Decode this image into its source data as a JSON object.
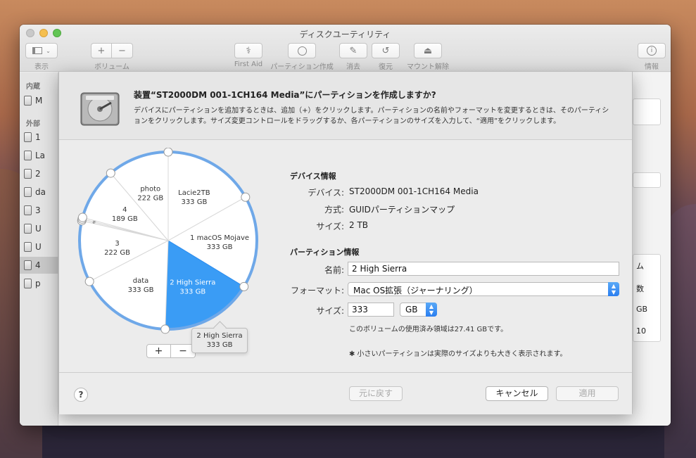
{
  "window": {
    "title": "ディスクユーティリティ"
  },
  "toolbar": {
    "view_label": "表示",
    "volume_label": "ボリューム",
    "volume_add": "+",
    "volume_remove": "−",
    "firstaid_label": "First Aid",
    "partition_label": "パーティション作成",
    "erase_label": "消去",
    "restore_label": "復元",
    "unmount_label": "マウント解除",
    "info_label": "情報"
  },
  "sidebar": {
    "internal_header": "内蔵",
    "external_header": "外部",
    "items": [
      "M",
      "1",
      "La",
      "2",
      "da",
      "3",
      "U",
      "U",
      "4",
      "p"
    ]
  },
  "background_panel": {
    "fragments": [
      "ム",
      "数",
      "GB",
      "10"
    ]
  },
  "sheet": {
    "title": "装置“ST2000DM 001-1CH164 Media”にパーティションを作成しますか?",
    "desc_line1": "デバイスにパーティションを追加するときは、追加（+）をクリックします。パーティションの名前やフォーマットを変更するときは、そのパーティシ",
    "desc_line2": "ョンをクリックします。サイズ変更コントロールをドラッグするか、各パーティションのサイズを入力して、“適用”をクリックします。"
  },
  "pie": {
    "total_gb": 2000,
    "slices": [
      {
        "name": "Lacie2TB",
        "size": "333 GB",
        "gb": 333,
        "selected": false
      },
      {
        "name": "1 macOS Mojave",
        "size": "333 GB",
        "gb": 333,
        "selected": false
      },
      {
        "name": "2 High Sierra",
        "size": "333 GB",
        "gb": 333,
        "selected": true
      },
      {
        "name": "data",
        "size": "333 GB",
        "gb": 333,
        "selected": false
      },
      {
        "name": "3",
        "size": "222 GB",
        "gb": 222,
        "selected": false
      },
      {
        "name": "*",
        "size": "",
        "gb": 6,
        "selected": false
      },
      {
        "name": "*",
        "size": "",
        "gb": 6,
        "selected": false
      },
      {
        "name": "4",
        "size": "189 GB",
        "gb": 189,
        "selected": false
      },
      {
        "name": "photo",
        "size": "222 GB",
        "gb": 222,
        "selected": false
      }
    ],
    "add_button": "+",
    "remove_button": "−",
    "tooltip_name": "2 High Sierra",
    "tooltip_size": "333 GB"
  },
  "colors": {
    "accent": "#2a8cf0",
    "selected_slice": "#3a9cf5",
    "pie_border": "#6fa8e8"
  },
  "device_info": {
    "header": "デバイス情報",
    "device_label": "デバイス:",
    "device_value": "ST2000DM 001-1CH164 Media",
    "scheme_label": "方式:",
    "scheme_value": "GUIDパーティションマップ",
    "size_label": "サイズ:",
    "size_value": "2 TB"
  },
  "partition_info": {
    "header": "パーティション情報",
    "name_label": "名前:",
    "name_value": "2 High Sierra",
    "format_label": "フォーマット:",
    "format_value": "Mac OS拡張（ジャーナリング）",
    "size_label": "サイズ:",
    "size_value": "333",
    "unit_value": "GB",
    "used_note": "このボリュームの使用済み領域は27.41 GBです。",
    "small_note": "✱ 小さいパーティションは実際のサイズよりも大きく表示されます。"
  },
  "footer": {
    "help": "?",
    "revert": "元に戻す",
    "cancel": "キャンセル",
    "apply": "適用"
  }
}
